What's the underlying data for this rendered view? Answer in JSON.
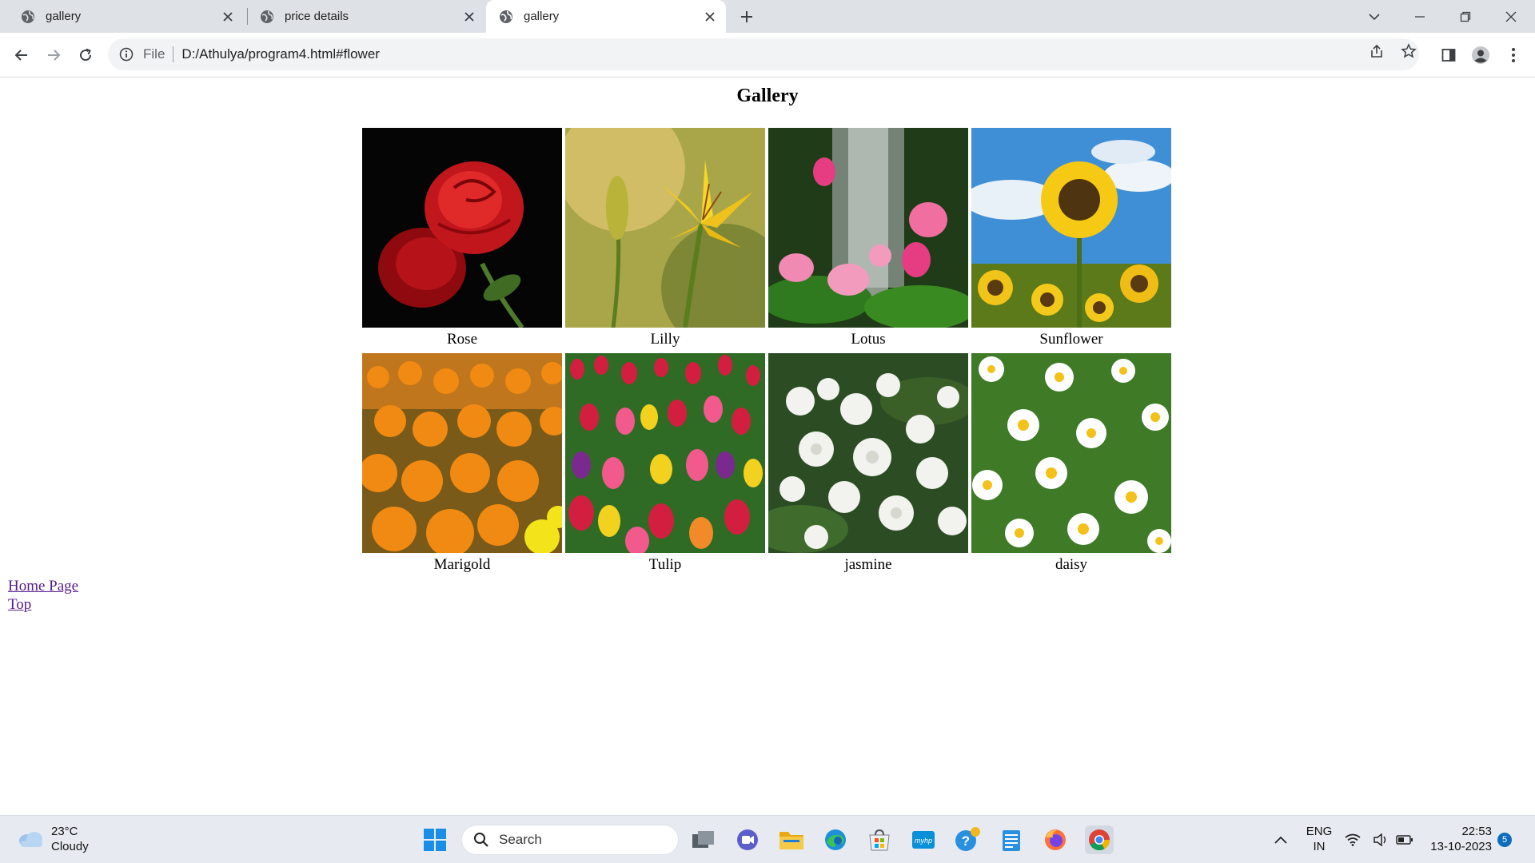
{
  "browser": {
    "tabs": [
      {
        "title": "gallery",
        "active": false
      },
      {
        "title": "price details",
        "active": false
      },
      {
        "title": "gallery",
        "active": true
      }
    ],
    "address": {
      "scheme": "File",
      "url": "D:/Athulya/program4.html#flower"
    }
  },
  "page": {
    "heading": "Gallery",
    "flowers": [
      {
        "name": "Rose",
        "scene": "rose"
      },
      {
        "name": "Lilly",
        "scene": "lily"
      },
      {
        "name": "Lotus",
        "scene": "lotus"
      },
      {
        "name": "Sunflower",
        "scene": "sunflower"
      },
      {
        "name": "Marigold",
        "scene": "marigold"
      },
      {
        "name": "Tulip",
        "scene": "tulip"
      },
      {
        "name": "jasmine",
        "scene": "jasmine"
      },
      {
        "name": "daisy",
        "scene": "daisy"
      }
    ],
    "links": {
      "home": "Home Page",
      "top": "Top"
    }
  },
  "taskbar": {
    "weather": {
      "temp": "23°C",
      "condition": "Cloudy"
    },
    "search_placeholder": "Search",
    "language": {
      "line1": "ENG",
      "line2": "IN"
    },
    "time": "22:53",
    "date": "13-10-2023",
    "notification_count": "5"
  },
  "colors": {
    "tabstrip": "#dee1e6",
    "taskbar": "#e7ebf1",
    "visited_link": "#551a8b",
    "chrome_accent": "#0f6cbd"
  }
}
